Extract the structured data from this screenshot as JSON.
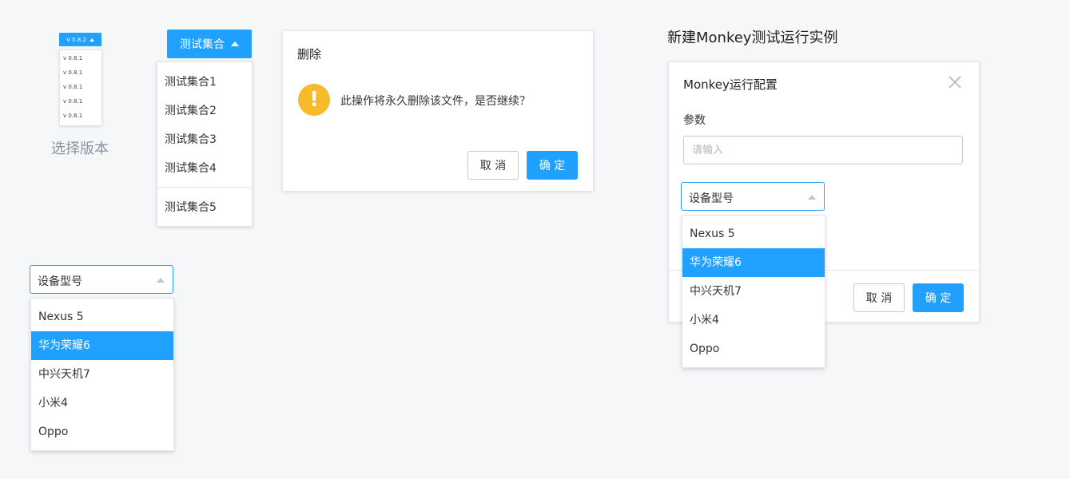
{
  "version_selector": {
    "current": "V 0.8.2",
    "options": [
      "v 0.8.1",
      "v 0.8.1",
      "v 0.8.1",
      "v 0.8.1",
      "v 0.8.1"
    ],
    "caption": "选择版本"
  },
  "test_set_dropdown": {
    "button_label": "测试集合",
    "items": [
      "测试集合1",
      "测试集合2",
      "测试集合3",
      "测试集合4",
      "测试集合5"
    ]
  },
  "delete_dialog": {
    "title": "删除",
    "message": "此操作将永久删除该文件，是否继续？",
    "cancel_label": "取 消",
    "confirm_label": "确 定"
  },
  "device_select": {
    "value": "设备型号",
    "options": [
      "Nexus 5",
      "华为荣耀6",
      "中兴天机7",
      "小米4",
      "Oppo"
    ],
    "highlighted": "华为荣耀6"
  },
  "monkey": {
    "heading": "新建Monkey测试运行实例",
    "dialog_title": "Monkey运行配置",
    "param_label": "参数",
    "param_placeholder": "请输入",
    "device_select": {
      "value": "设备型号",
      "options": [
        "Nexus 5",
        "华为荣耀6",
        "中兴天机7",
        "小米4",
        "Oppo"
      ],
      "highlighted": "华为荣耀6"
    },
    "cancel_label": "取 消",
    "confirm_label": "确 定"
  },
  "colors": {
    "primary": "#20a0ff",
    "warning": "#f7ba2a",
    "background": "#f6f7f9"
  },
  "icons": {
    "warning": "exclamation-icon",
    "close": "close-icon",
    "caret": "caret-up-icon"
  }
}
